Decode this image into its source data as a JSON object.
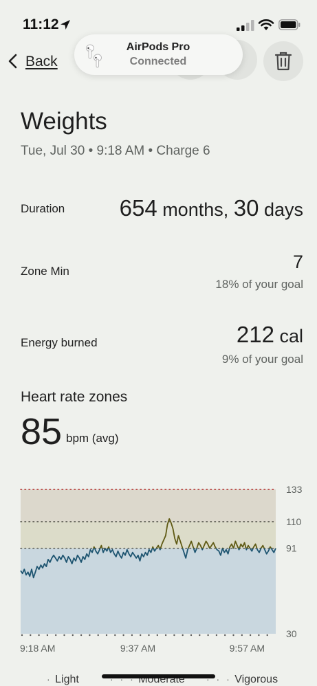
{
  "status_bar": {
    "time": "11:12",
    "icons": [
      "location-arrow-icon",
      "cellular-signal-icon",
      "wifi-icon",
      "battery-icon"
    ]
  },
  "nav": {
    "back_label": "Back",
    "icons": [
      "chevron-left-icon",
      "trash-icon"
    ]
  },
  "toast": {
    "title": "AirPods Pro",
    "subtitle": "Connected",
    "icon": "airpods-icon"
  },
  "header": {
    "title": "Weights",
    "subtitle": "Tue, Jul 30 • 9:18 AM • Charge 6"
  },
  "metrics": {
    "duration": {
      "label": "Duration",
      "value1": "654",
      "unit1": " months, ",
      "value2": "30",
      "unit2": " days"
    },
    "zone_min": {
      "label": "Zone Min",
      "value": "7",
      "goal": "18% of your goal"
    },
    "energy": {
      "label": "Energy burned",
      "value": "212",
      "unit": " cal",
      "goal": "9% of your goal"
    }
  },
  "heart_rate": {
    "title": "Heart rate zones",
    "value": "85",
    "unit": "bpm (avg)"
  },
  "chart_data": {
    "type": "line",
    "x_labels": [
      "9:18 AM",
      "9:37 AM",
      "9:57 AM"
    ],
    "y_ticks": [
      133,
      110,
      91,
      30
    ],
    "ylim": [
      30,
      133
    ],
    "zones": [
      {
        "name": "Light",
        "from": 30,
        "to": 91,
        "color": "#c9d7df"
      },
      {
        "name": "Moderate",
        "from": 91,
        "to": 110,
        "color": "#dcdcc9"
      },
      {
        "name": "Vigorous",
        "from": 110,
        "to": 133,
        "color": "#dcd8cc"
      }
    ],
    "colors": {
      "below": "#1d5470",
      "above": "#5f5a14",
      "vigorous_line": "#b02a2a",
      "dotted": "#5a5a50"
    },
    "x": [
      0,
      1,
      2,
      3,
      4,
      5,
      6,
      7,
      8,
      9,
      10,
      11,
      12,
      13,
      14,
      15,
      16,
      17,
      18,
      19,
      20,
      21,
      22,
      23,
      24,
      25,
      26,
      27,
      28,
      29,
      30,
      31,
      32,
      33,
      34,
      35,
      36,
      37,
      38,
      39,
      40,
      41,
      42,
      43,
      44,
      45,
      46,
      47,
      48,
      49,
      50,
      51,
      52,
      53,
      54,
      55,
      56,
      57,
      58,
      59,
      60,
      61,
      62,
      63,
      64,
      65,
      66,
      67,
      68,
      69,
      70,
      71,
      72,
      73,
      74,
      75,
      76,
      77,
      78,
      79,
      80,
      81,
      82,
      83,
      84,
      85,
      86,
      87,
      88,
      89,
      90,
      91,
      92,
      93,
      94,
      95,
      96,
      97,
      98,
      99,
      100,
      101,
      102,
      103,
      104,
      105,
      106,
      107,
      108,
      109,
      110,
      111,
      112,
      113,
      114,
      115,
      116,
      117,
      118,
      119,
      120,
      121,
      122,
      123,
      124,
      125,
      126,
      127,
      128,
      129,
      130,
      131,
      132,
      133,
      134,
      135,
      136,
      137,
      138,
      139
    ],
    "values": [
      75,
      73,
      76,
      72,
      74,
      71,
      76,
      70,
      74,
      78,
      76,
      79,
      77,
      80,
      78,
      83,
      81,
      84,
      86,
      84,
      82,
      85,
      83,
      86,
      84,
      81,
      85,
      83,
      80,
      84,
      82,
      86,
      84,
      81,
      85,
      83,
      87,
      85,
      90,
      88,
      92,
      89,
      87,
      90,
      93,
      88,
      91,
      89,
      92,
      88,
      90,
      87,
      85,
      89,
      86,
      84,
      88,
      86,
      90,
      87,
      85,
      88,
      86,
      84,
      86,
      82,
      87,
      85,
      88,
      86,
      90,
      88,
      92,
      89,
      91,
      93,
      90,
      94,
      97,
      100,
      108,
      112,
      109,
      105,
      98,
      94,
      100,
      96,
      92,
      88,
      84,
      90,
      93,
      96,
      92,
      88,
      91,
      95,
      93,
      90,
      93,
      96,
      94,
      91,
      93,
      95,
      92,
      90,
      89,
      86,
      91,
      88,
      90,
      87,
      92,
      94,
      91,
      96,
      93,
      90,
      94,
      92,
      95,
      90,
      93,
      91,
      89,
      92,
      94,
      90,
      88,
      91,
      93,
      90,
      87,
      89,
      92,
      90,
      88,
      91
    ]
  },
  "legend": {
    "items": [
      "Light",
      "Moderate",
      "Vigorous"
    ]
  }
}
